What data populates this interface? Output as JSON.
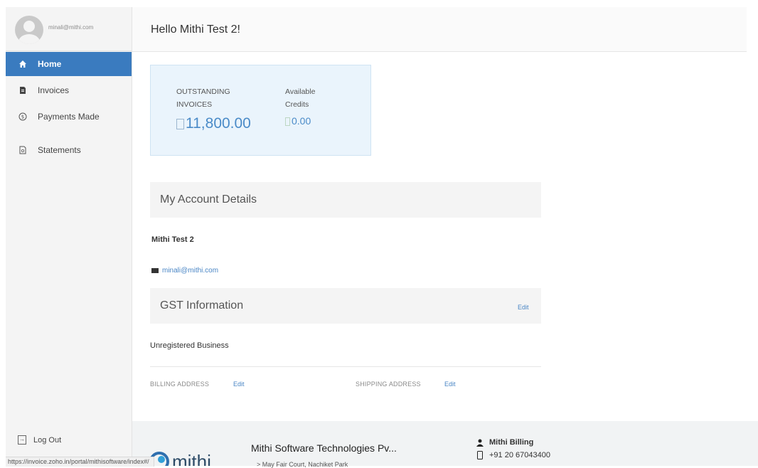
{
  "profile": {
    "email": "minali@mithi.com"
  },
  "nav": [
    {
      "label": "Home",
      "icon": "home-icon"
    },
    {
      "label": "Invoices",
      "icon": "invoice-icon"
    },
    {
      "label": "Payments Made",
      "icon": "payment-icon"
    },
    {
      "label": "Statements",
      "icon": "statement-icon"
    }
  ],
  "logout_label": "Log Out",
  "header": {
    "greeting": "Hello Mithi Test 2!"
  },
  "summary": {
    "outstanding_label_line1": "OUTSTANDING",
    "outstanding_label_line2": "INVOICES",
    "outstanding_value": "11,800.00",
    "credits_label_line1": "Available",
    "credits_label_line2": "Credits",
    "credits_value": "0.00"
  },
  "account": {
    "title": "My Account Details",
    "name": "Mithi Test 2",
    "email": "minali@mithi.com"
  },
  "gst": {
    "title": "GST Information",
    "edit_label": "Edit",
    "business_type": "Unregistered Business"
  },
  "addresses": {
    "billing_label": "BILLING ADDRESS",
    "billing_edit": "Edit",
    "shipping_label": "SHIPPING ADDRESS",
    "shipping_edit": "Edit"
  },
  "footer": {
    "logo_text": "mithi",
    "company": "Mithi Software Technologies Pv...",
    "contact_name": "Mithi Billing",
    "contact_phone": "+91 20 67043400",
    "address_partial": "> May Fair Court, Nachiket Park"
  },
  "status_bar": {
    "url": "https://invoice.zoho.in/portal/mithisoftware/index#/"
  },
  "colors": {
    "accent": "#3a7bbf",
    "link": "#4a86c5",
    "card_bg": "#eaf4fc"
  }
}
